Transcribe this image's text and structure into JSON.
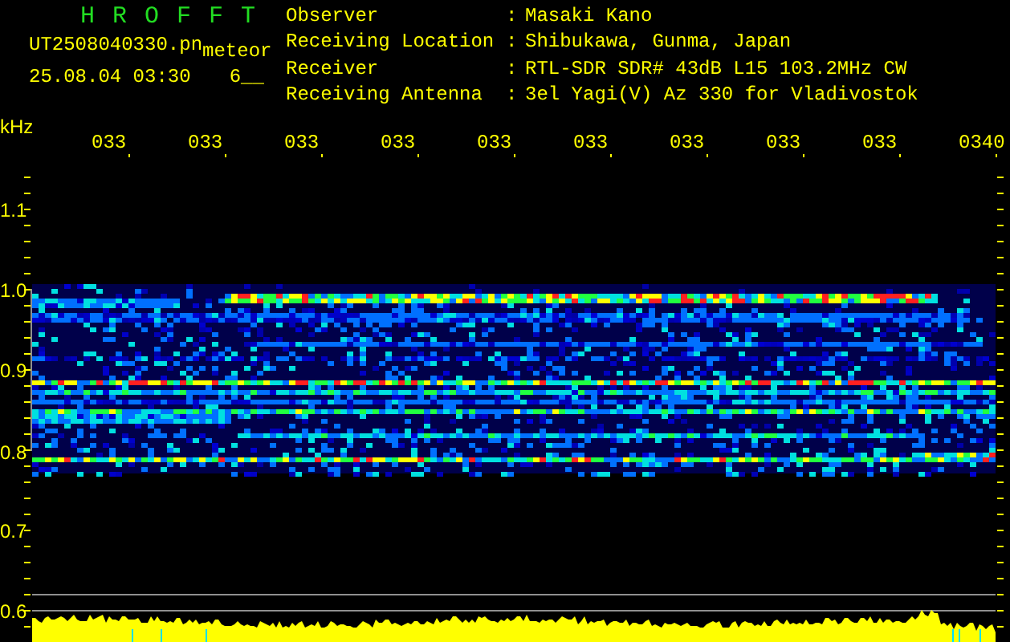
{
  "header": {
    "title": "H R O F F T",
    "file_name": "UT2508040330.pn",
    "mode": "meteor",
    "timestamp": "25.08.04 03:30",
    "count": "6__"
  },
  "info": [
    {
      "label": "Observer",
      "separator": ":",
      "value": "Masaki Kano"
    },
    {
      "label": "Receiving Location",
      "separator": ":",
      "value": "Shibukawa, Gunma, Japan"
    },
    {
      "label": "Receiver",
      "separator": ":",
      "value": "RTL-SDR SDR# 43dB L15 103.2MHz CW"
    },
    {
      "label": "Receiving Antenna",
      "separator": ":",
      "value": "3el Yagi(V) Az 330 for Vladivostok"
    }
  ],
  "spectrogram": {
    "unit": "kHz",
    "x_ticks": [
      "033",
      "033",
      "033",
      "033",
      "033",
      "033",
      "033",
      "033",
      "033",
      "0340"
    ],
    "y_ticks": [
      "1.1",
      "1.0",
      "0.9",
      "0.8",
      "0.7",
      "0.6"
    ]
  }
}
